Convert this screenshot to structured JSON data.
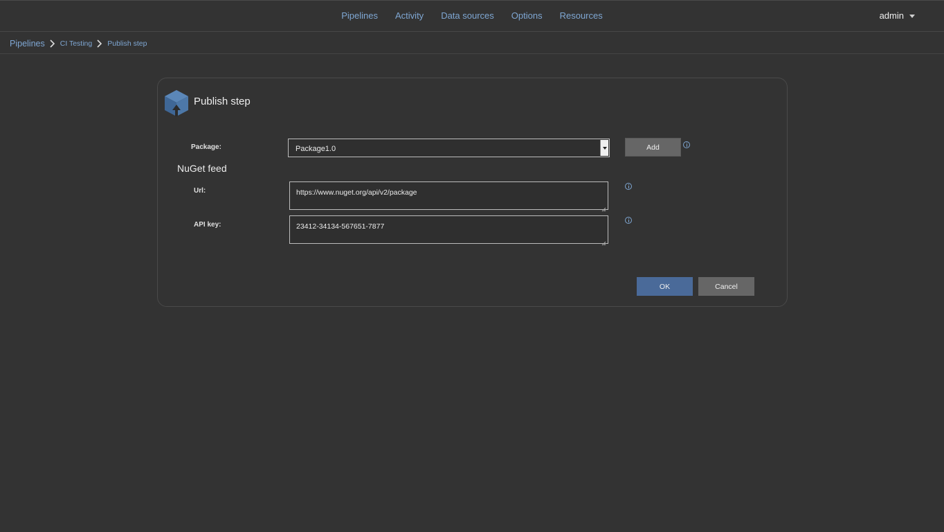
{
  "topnav": {
    "items": [
      {
        "label": "Pipelines"
      },
      {
        "label": "Activity"
      },
      {
        "label": "Data sources"
      },
      {
        "label": "Options"
      },
      {
        "label": "Resources"
      }
    ],
    "user": "admin"
  },
  "breadcrumb": {
    "items": [
      {
        "label": "Pipelines"
      },
      {
        "label": "CI Testing"
      },
      {
        "label": "Publish step"
      }
    ]
  },
  "dialog": {
    "title": "Publish step",
    "package_label": "Package:",
    "package_value": "Package1.0",
    "add_label": "Add",
    "section_title": "NuGet feed",
    "url_label": "Url:",
    "url_value": "https://www.nuget.org/api/v2/package",
    "apikey_label": "API key:",
    "apikey_value": "23412-34134-567651-7877",
    "ok_label": "OK",
    "cancel_label": "Cancel"
  },
  "colors": {
    "background": "#333333",
    "link": "#7fa7d3",
    "primary_button": "#4a6a99",
    "secondary_button": "#666666"
  },
  "icons": [
    "chevron-down-icon",
    "chevron-right-icon",
    "cube-logo-icon",
    "info-icon",
    "resize-grip-icon"
  ]
}
